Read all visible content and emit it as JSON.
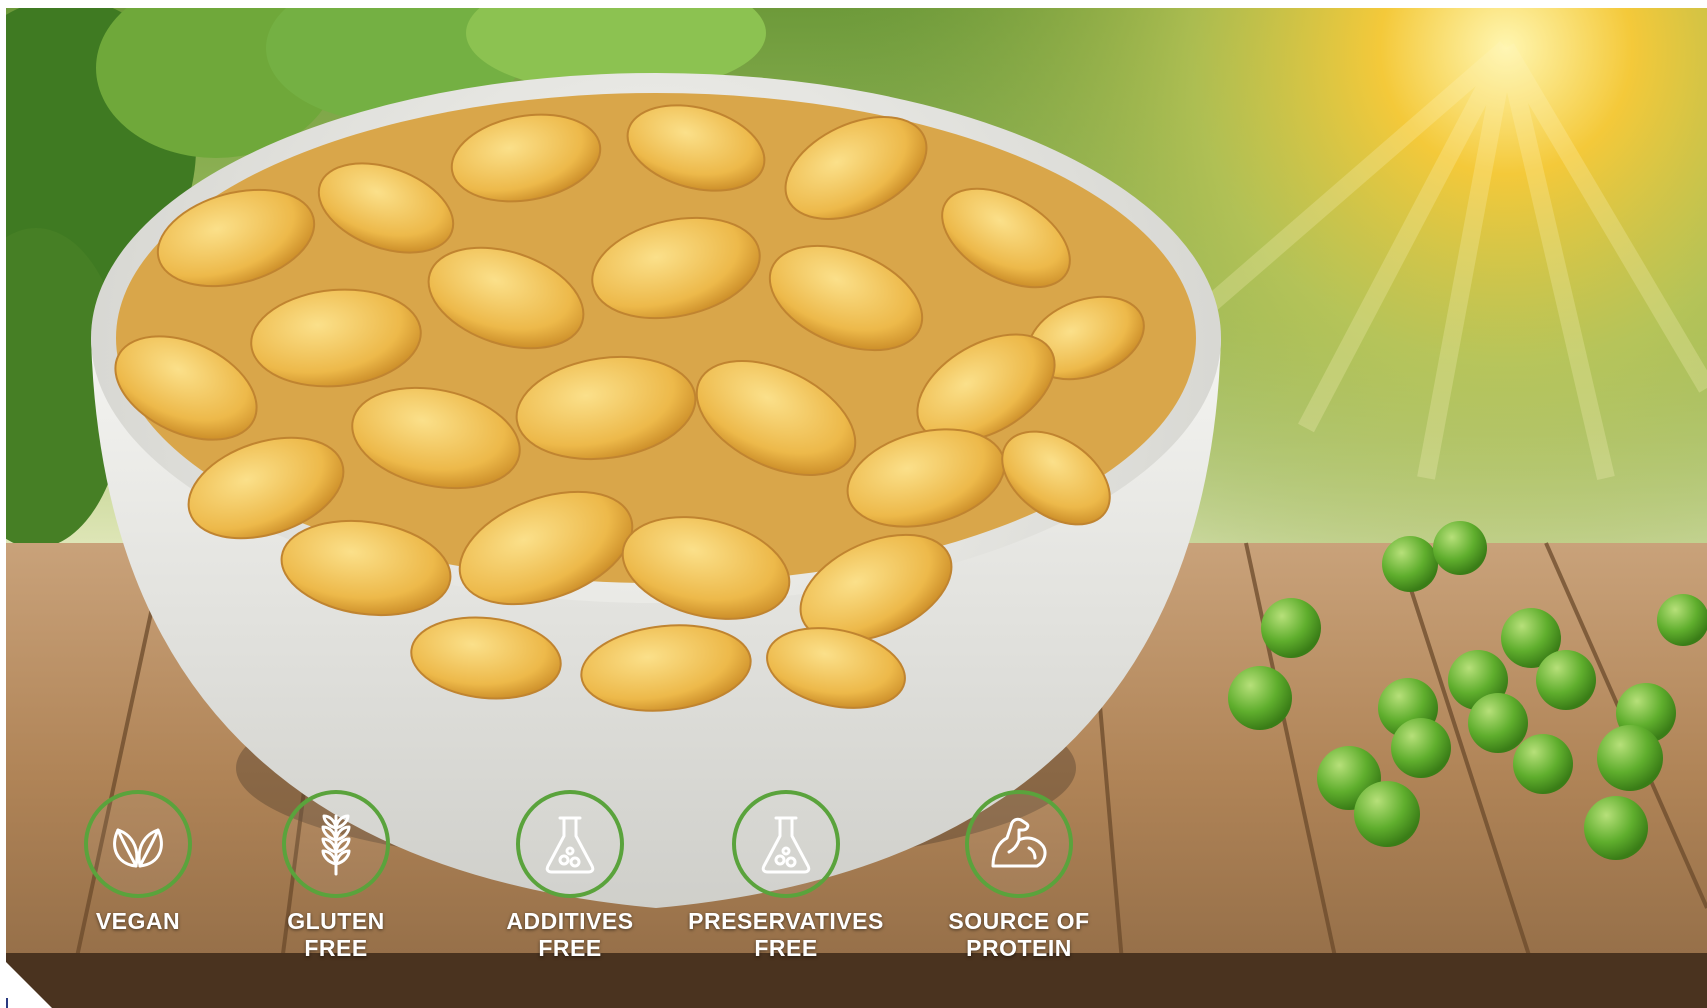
{
  "colors": {
    "badge_ring": "#5aa33c",
    "badge_text": "#ffffff",
    "corner_mark": "#2a3a80"
  },
  "badges": [
    {
      "icon": "vegan-leaves-icon",
      "label": "VEGAN"
    },
    {
      "icon": "wheat-icon",
      "label": "GLUTEN\nFREE"
    },
    {
      "icon": "flask-icon",
      "label": "ADDITIVES\nFREE"
    },
    {
      "icon": "flask-icon",
      "label": "PRESERVATIVES\nFREE"
    },
    {
      "icon": "flexed-arm-icon",
      "label": "SOURCE OF\nPROTEIN"
    }
  ]
}
